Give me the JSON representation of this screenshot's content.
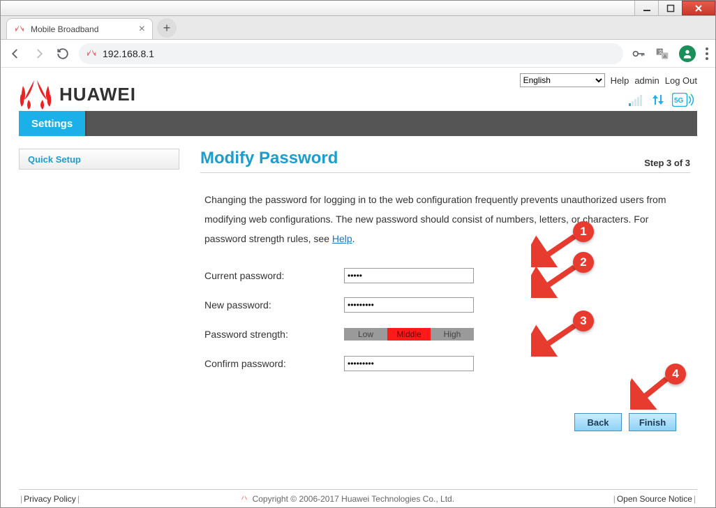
{
  "browser": {
    "tab_title": "Mobile Broadband",
    "url": "192.168.8.1"
  },
  "header": {
    "brand": "HUAWEI",
    "language_options": [
      "English"
    ],
    "language_selected": "English",
    "links": {
      "help": "Help",
      "user": "admin",
      "logout": "Log Out"
    }
  },
  "nav": {
    "settings": "Settings"
  },
  "sidebar": {
    "quick_setup": "Quick Setup"
  },
  "main": {
    "title": "Modify Password",
    "step": "Step 3 of 3",
    "description_pre": "Changing the password for logging in to the web configuration frequently prevents unauthorized users from modifying web configurations. The new password should consist of numbers, letters, or characters. For password strength rules, see ",
    "description_link": "Help",
    "description_post": ".",
    "labels": {
      "current": "Current password:",
      "new": "New password:",
      "strength": "Password strength:",
      "confirm": "Confirm password:"
    },
    "values": {
      "current": "•••••",
      "new": "•••••••••",
      "confirm": "•••••••••"
    },
    "strength": {
      "low": "Low",
      "middle": "Middle",
      "high": "High",
      "level": "middle"
    },
    "buttons": {
      "back": "Back",
      "finish": "Finish"
    }
  },
  "footer": {
    "privacy": "Privacy Policy",
    "copyright": "Copyright © 2006-2017 Huawei Technologies Co., Ltd.",
    "open_source": "Open Source Notice"
  },
  "annotations": {
    "c1": "1",
    "c2": "2",
    "c3": "3",
    "c4": "4"
  }
}
